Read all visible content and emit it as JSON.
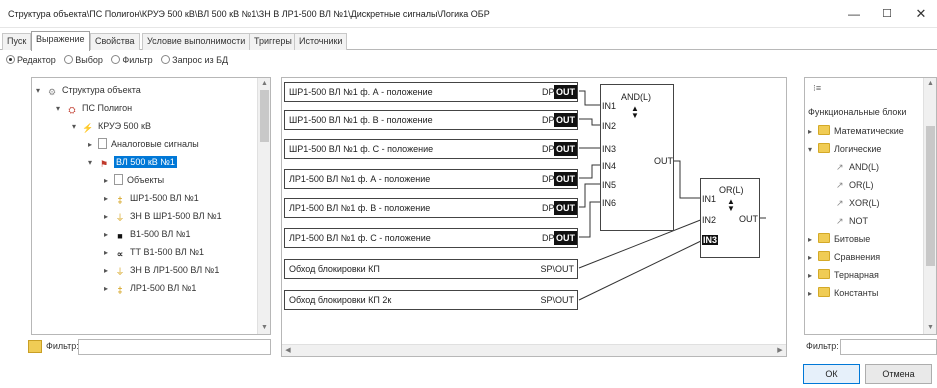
{
  "window": {
    "title": "Структура объекта\\ПС Полигон\\КРУЭ 500 кВ\\ВЛ 500 кВ №1\\ЗН В ЛР1-500 ВЛ №1\\Дискретные сигналы\\Логика ОБР",
    "minimize": "—",
    "maximize": "☐",
    "close": "✕"
  },
  "tabs": [
    "Пуск",
    "Выражение",
    "Свойства",
    "Условие выполнимости",
    "Триггеры",
    "Источники"
  ],
  "active_tab": "Выражение",
  "modes": [
    {
      "label": "Редактор",
      "selected": true
    },
    {
      "label": "Выбор",
      "selected": false
    },
    {
      "label": "Фильтр",
      "selected": false
    },
    {
      "label": "Запрос из БД",
      "selected": false
    }
  ],
  "tree": [
    {
      "label": "Структура объекта",
      "expander": "▾",
      "icon": "gear-icon",
      "glyph": "⚙"
    },
    {
      "label": "ПС Полигон",
      "expander": "▾",
      "icon": "substation-icon",
      "glyph": "⛭"
    },
    {
      "label": "КРУЭ 500 кВ",
      "expander": "▾",
      "icon": "switchgear-icon",
      "glyph": "⚡"
    },
    {
      "label": "Аналоговые сигналы",
      "expander": "▸",
      "icon": "document-icon",
      "glyph": ""
    },
    {
      "label": "ВЛ 500 кВ №1",
      "expander": "▾",
      "icon": "line-icon",
      "glyph": "⚑"
    },
    {
      "label": "Объекты",
      "expander": "▸",
      "icon": "document-icon",
      "glyph": ""
    },
    {
      "label": "ШР1-500 ВЛ №1",
      "expander": "▸",
      "icon": "disconnector-icon",
      "glyph": "‡"
    },
    {
      "label": "ЗН В ШР1-500 ВЛ №1",
      "expander": "▸",
      "icon": "grounding-icon",
      "glyph": "⏚"
    },
    {
      "label": "В1-500 ВЛ №1",
      "expander": "▸",
      "icon": "breaker-icon",
      "glyph": "■"
    },
    {
      "label": "ТТ В1-500 ВЛ №1",
      "expander": "▸",
      "icon": "transformer-icon",
      "glyph": "∝"
    },
    {
      "label": "ЗН В ЛР1-500 ВЛ №1",
      "expander": "▸",
      "icon": "grounding-icon",
      "glyph": "⏚"
    },
    {
      "label": "ЛР1-500 ВЛ №1",
      "expander": "▸",
      "icon": "disconnector-icon",
      "glyph": "‡"
    }
  ],
  "selected_tree_item": "ВЛ 500 кВ №1",
  "filter_label": "Фильтр:",
  "filter_value": "",
  "variables": [
    {
      "label": "ШР1-500 ВЛ №1 ф. А - положение",
      "type": "DP\\",
      "port": "OUT"
    },
    {
      "label": "ШР1-500 ВЛ №1 ф. В - положение",
      "type": "DP\\",
      "port": "OUT"
    },
    {
      "label": "ШР1-500 ВЛ №1 ф. С - положение",
      "type": "DP\\",
      "port": "OUT"
    },
    {
      "label": "ЛР1-500 ВЛ №1 ф. А - положение",
      "type": "DP\\",
      "port": "OUT"
    },
    {
      "label": "ЛР1-500 ВЛ №1 ф. В - положение",
      "type": "DP\\",
      "port": "OUT"
    },
    {
      "label": "ЛР1-500 ВЛ №1 ф. С - положение",
      "type": "DP\\",
      "port": "OUT"
    },
    {
      "label": "Обход блокировки КП",
      "type": "SP\\OUT",
      "port": ""
    },
    {
      "label": "Обход блокировки КП 2к",
      "type": "SP\\OUT",
      "port": ""
    }
  ],
  "and_block": {
    "name": "AND(L)",
    "inputs": [
      "IN1",
      "IN2",
      "IN3",
      "IN4",
      "IN5",
      "IN6"
    ],
    "output": "OUT"
  },
  "or_block": {
    "name": "OR(L)",
    "inputs": [
      "IN1",
      "IN2",
      "IN3"
    ],
    "output": "OUT",
    "highlighted_input": "IN3"
  },
  "functional_blocks": {
    "title": "Функциональные блоки",
    "items": [
      {
        "label": "Математические",
        "expander": "▸",
        "child": false
      },
      {
        "label": "Логические",
        "expander": "▾",
        "child": false
      },
      {
        "label": "AND(L)",
        "expander": "",
        "child": true
      },
      {
        "label": "OR(L)",
        "expander": "",
        "child": true
      },
      {
        "label": "XOR(L)",
        "expander": "",
        "child": true
      },
      {
        "label": "NOT",
        "expander": "",
        "child": true
      },
      {
        "label": "Битовые",
        "expander": "▸",
        "child": false
      },
      {
        "label": "Сравнения",
        "expander": "▸",
        "child": false
      },
      {
        "label": "Тернарная",
        "expander": "▸",
        "child": false
      },
      {
        "label": "Константы",
        "expander": "▸",
        "child": false
      }
    ]
  },
  "right_filter_label": "Фильтр:",
  "buttons": {
    "ok": "ОК",
    "cancel": "Отмена"
  },
  "colors": {
    "accent": "#0078d7",
    "folder": "#f0cc55",
    "port": "#111111"
  }
}
